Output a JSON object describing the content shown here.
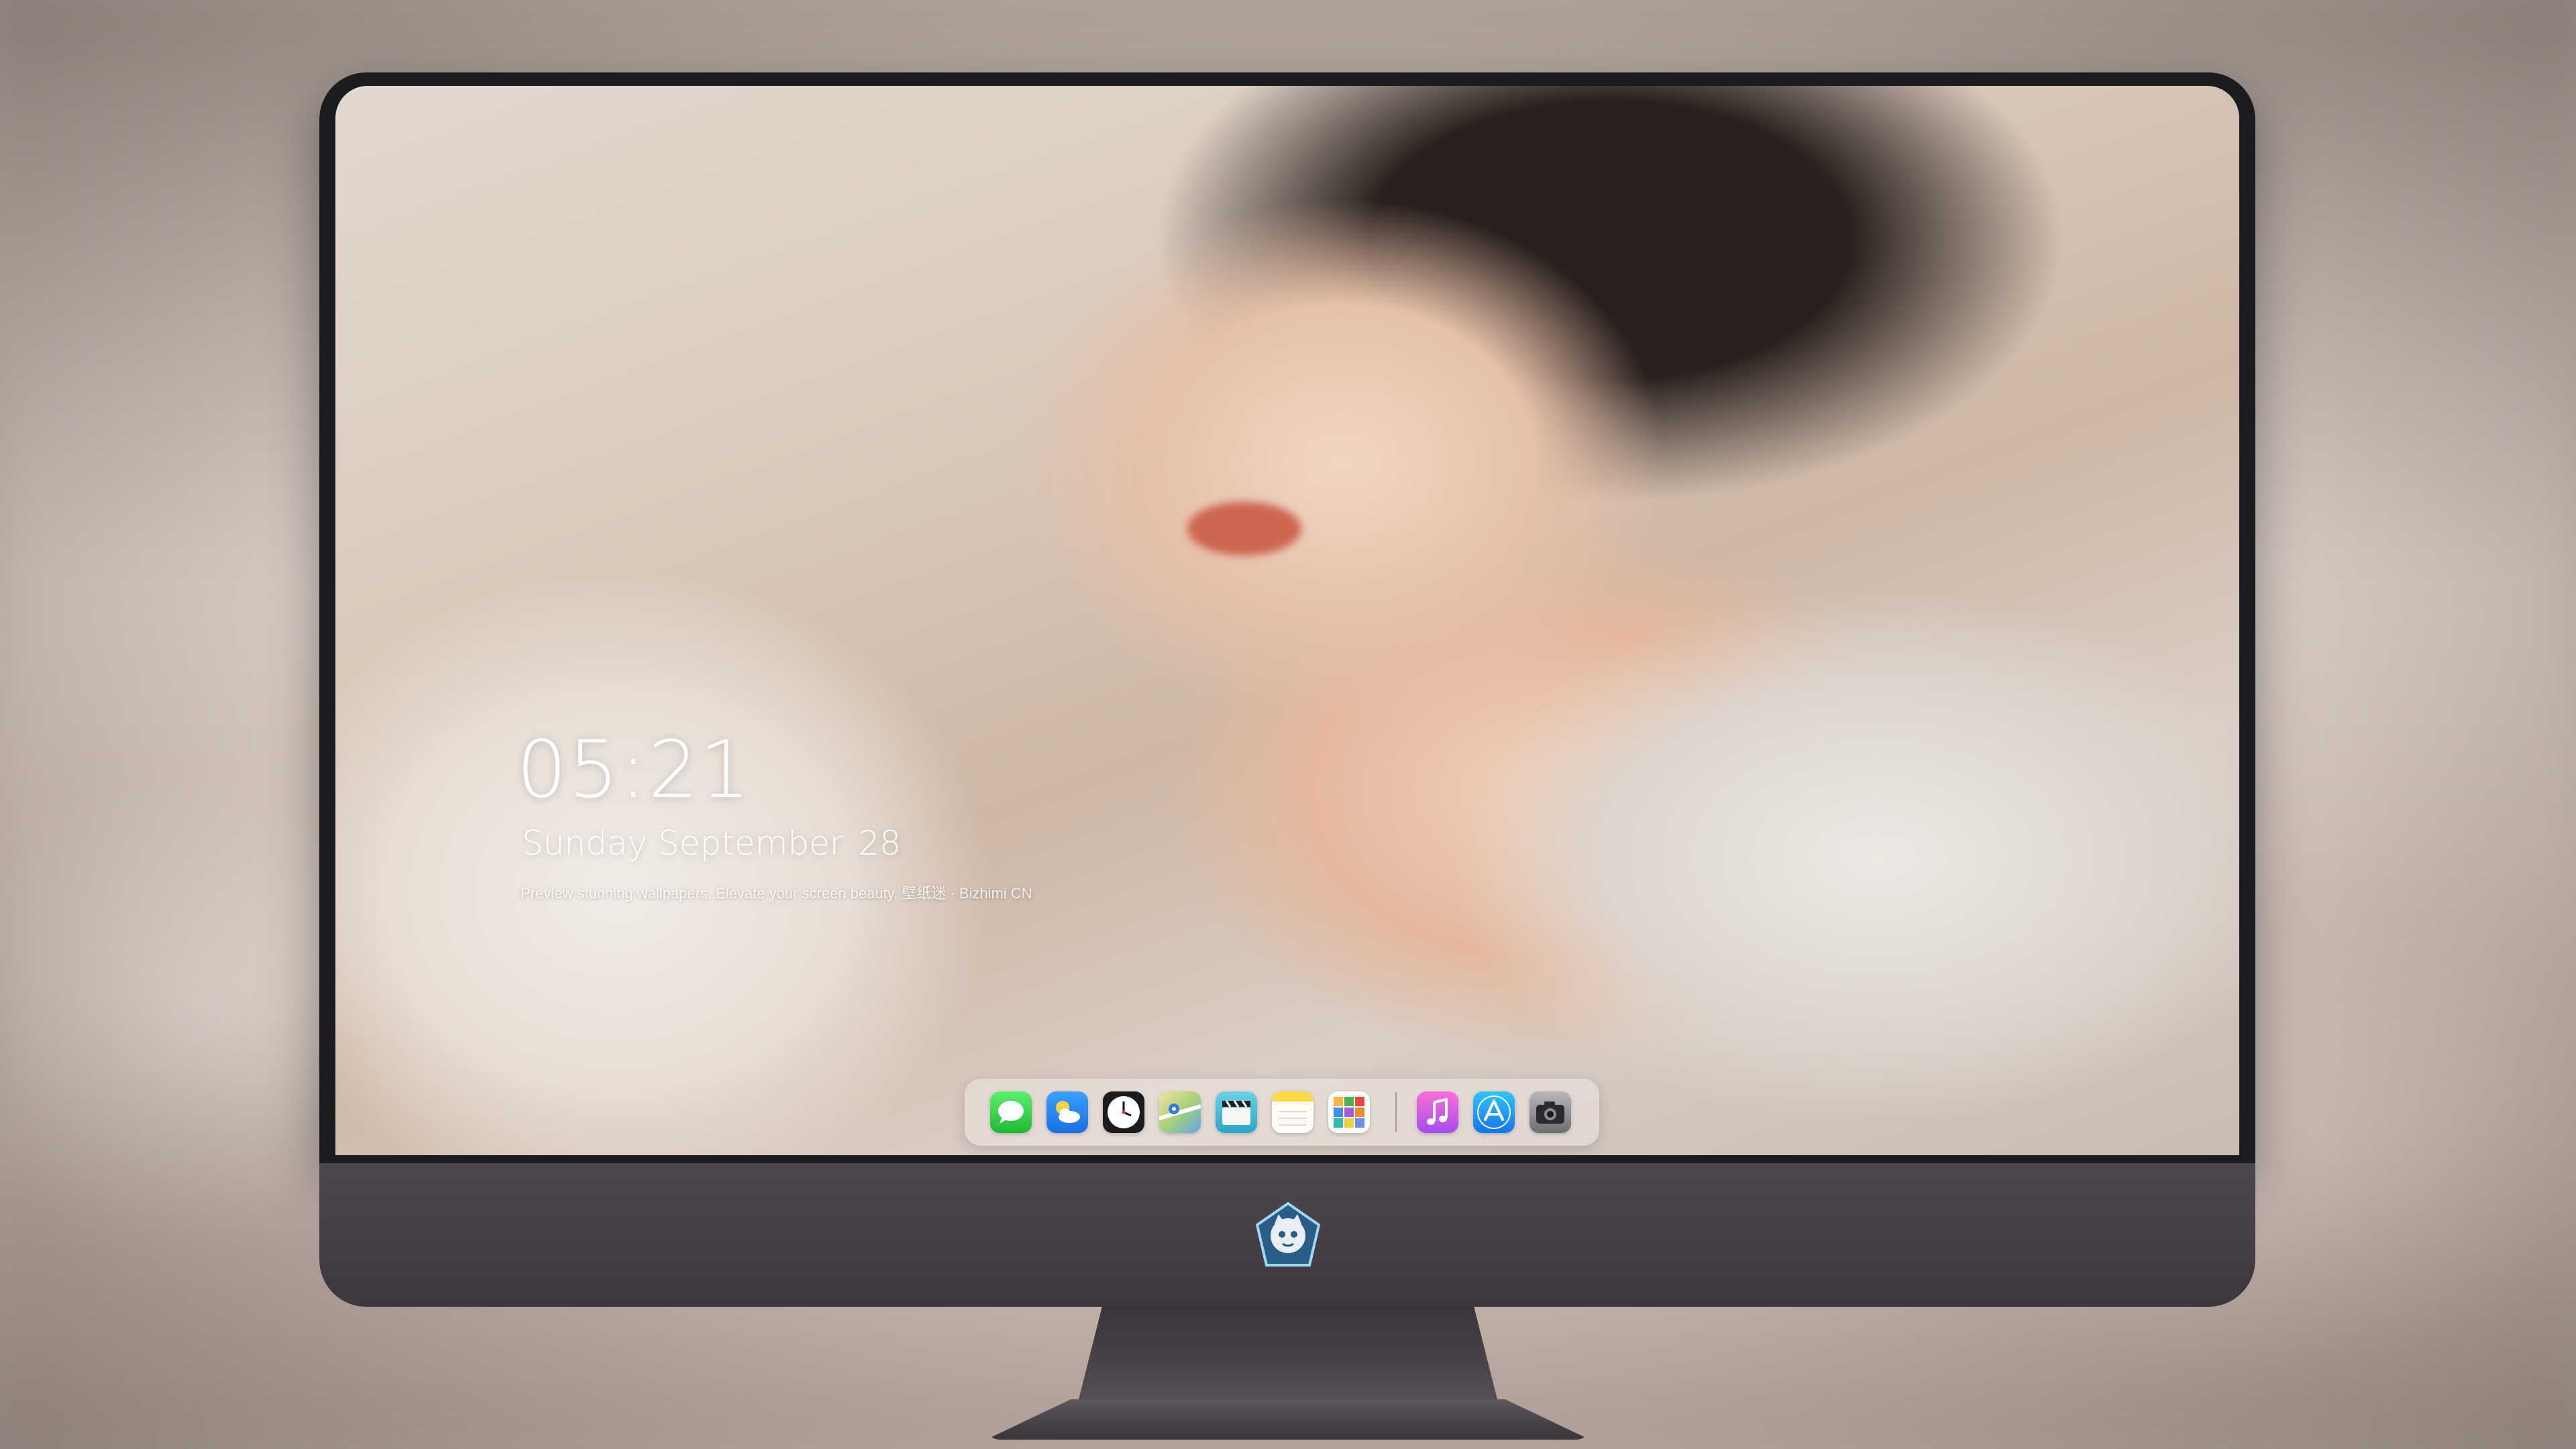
{
  "lock_screen": {
    "time": "05:21",
    "weekday_month": "Sunday September",
    "day": "28",
    "tagline": "Preview stunning wallpapers. Elevate your screen beauty. 壁纸迷 · Bizhimi CN"
  },
  "dock": {
    "apps": [
      {
        "name": "messages",
        "icon": "messages-icon"
      },
      {
        "name": "weather",
        "icon": "weather-icon"
      },
      {
        "name": "clock",
        "icon": "clock-icon"
      },
      {
        "name": "maps",
        "icon": "maps-icon"
      },
      {
        "name": "clips",
        "icon": "clapperboard-icon"
      },
      {
        "name": "notes",
        "icon": "notes-icon"
      },
      {
        "name": "photos",
        "icon": "photo-grid-icon"
      },
      {
        "name": "music",
        "icon": "music-note-icon"
      },
      {
        "name": "app-store",
        "icon": "app-store-icon"
      },
      {
        "name": "camera",
        "icon": "camera-icon"
      }
    ]
  },
  "colors": {
    "bezel": "#1c1b1f",
    "chin": "#4e464d",
    "clock_text": "#ffffff"
  },
  "brand": {
    "logo": "mascot-logo-icon"
  }
}
